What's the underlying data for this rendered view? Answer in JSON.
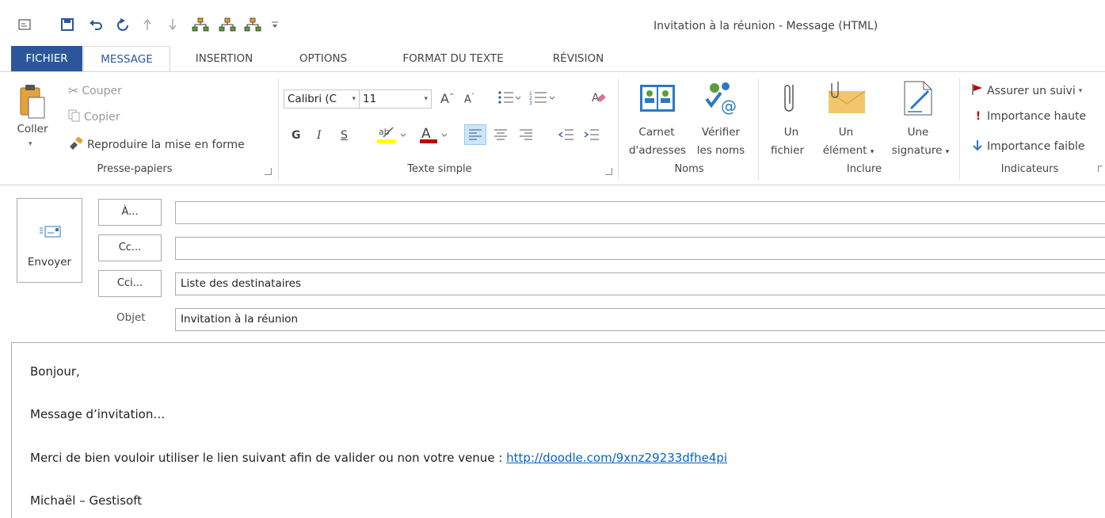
{
  "window": {
    "title": "Invitation à la réunion - Message (HTML)"
  },
  "tabs": [
    "FICHIER",
    "MESSAGE",
    "INSERTION",
    "OPTIONS",
    "FORMAT DU TEXTE",
    "RÉVISION"
  ],
  "clipboard": {
    "group": "Presse-papiers",
    "paste": "Coller",
    "cut": "Couper",
    "copy": "Copier",
    "format_painter": "Reproduire la mise en forme"
  },
  "text": {
    "group": "Texte simple",
    "font": "Calibri (C",
    "size": "11",
    "bold": "G",
    "italic": "I",
    "underline": "S"
  },
  "names": {
    "group": "Noms",
    "address_book": [
      "Carnet",
      "d'adresses"
    ],
    "check_names": [
      "Vérifier",
      "les noms"
    ]
  },
  "include": {
    "group": "Inclure",
    "file": [
      "Un",
      "fichier"
    ],
    "item": [
      "Un",
      "élément"
    ],
    "signature": [
      "Une",
      "signature"
    ]
  },
  "flags": {
    "group": "Indicateurs",
    "follow_up": "Assurer un suivi",
    "high": "Importance haute",
    "low": "Importance faible"
  },
  "compose": {
    "send": "Envoyer",
    "to_btn": "À...",
    "cc_btn": "Cc...",
    "bcc_btn": "Cci...",
    "to": "",
    "cc": "",
    "bcc": "Liste des destinataires",
    "subject_label": "Objet",
    "subject": "Invitation à la réunion"
  },
  "body": {
    "line1": "Bonjour,",
    "line2": "Message d’invitation…",
    "line3": "Merci de bien vouloir utiliser le lien suivant afin de valider ou non votre venue :",
    "link": "http://doodle.com/9xnz29233dfhe4pi",
    "line4": "Michaël – Gestisoft"
  },
  "colors": {
    "accent": "#2b579a",
    "highlight": "#ffff00",
    "font_color": "#c00000",
    "link": "#0563c1",
    "flag": "#c00000"
  }
}
